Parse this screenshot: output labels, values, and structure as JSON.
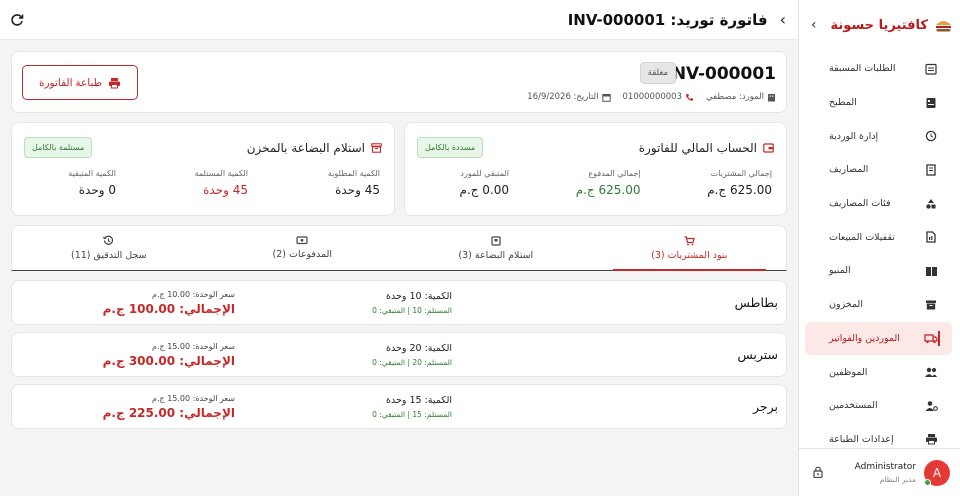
{
  "sidebar": {
    "title": "كافتيريا حسونة",
    "items": [
      {
        "label": "الطلبات المسبقة",
        "icon": "calendar-list-icon"
      },
      {
        "label": "المطبخ",
        "icon": "kitchen-icon"
      },
      {
        "label": "إدارة الوردية",
        "icon": "shift-clock-icon"
      },
      {
        "label": "المصاريف",
        "icon": "receipt-icon"
      },
      {
        "label": "فئات المصاريف",
        "icon": "categories-icon"
      },
      {
        "label": "تقفيلات المبيعات",
        "icon": "report-icon"
      },
      {
        "label": "المنيو",
        "icon": "menu-book-icon"
      },
      {
        "label": "المخزون",
        "icon": "inventory-icon"
      },
      {
        "label": "الموردين والفواتير",
        "icon": "truck-icon",
        "active": true
      },
      {
        "label": "الموظفين",
        "icon": "people-icon"
      },
      {
        "label": "المستخدمين",
        "icon": "user-settings-icon"
      },
      {
        "label": "إعدادات الطباعة",
        "icon": "printer-icon"
      }
    ],
    "user": {
      "name": "Administrator",
      "role": "مدير النظام",
      "initial": "A"
    }
  },
  "header": {
    "title": "فاتورة توريد: INV-000001"
  },
  "invoice": {
    "number": "INV-000001",
    "status": "مغلقة",
    "supplier": "المورد: مصطفي",
    "phone": "01000000003",
    "date": "التاريخ: 16/9/2026",
    "print_label": "طباعة الفاتورة"
  },
  "financial": {
    "title": "الحساب المالي للفاتورة",
    "badge": "مسددة بالكامل",
    "total_label": "إجمالي المشتريات",
    "total_value": "625.00 ج.م",
    "paid_label": "إجمالي المدفوع",
    "paid_value": "625.00 ج.م",
    "remaining_label": "المتبقي للمورد",
    "remaining_value": "0.00 ج.م"
  },
  "receiving": {
    "title": "استلام البضاعة بالمخزن",
    "badge": "مستلمة بالكامل",
    "requested_label": "الكمية المطلوبة",
    "requested_value": "45 وحدة",
    "received_label": "الكمية المستلمة",
    "received_value": "45 وحدة",
    "remaining_label": "الكمية المتبقية",
    "remaining_value": "0 وحدة"
  },
  "tabs": [
    {
      "label": "بنود المشتريات (3)",
      "icon": "cart-icon",
      "active": true
    },
    {
      "label": "استلام البضاعة (3)",
      "icon": "box-icon"
    },
    {
      "label": "المدفوعات (2)",
      "icon": "cash-icon"
    },
    {
      "label": "سجل التدقيق (11)",
      "icon": "history-icon"
    }
  ],
  "items": [
    {
      "name": "بطاطس",
      "qty": "الكمية: 10 وحدة",
      "recv": "المستلم: 10 | المتبقي: 0",
      "unit_price": "سعر الوحدة: 10.00 ج.م",
      "total": "الإجمالي: 100.00 ج.م"
    },
    {
      "name": "ستربس",
      "qty": "الكمية: 20 وحدة",
      "recv": "المستلم: 20 | المتبقي: 0",
      "unit_price": "سعر الوحدة: 15.00 ج.م",
      "total": "الإجمالي: 300.00 ج.م"
    },
    {
      "name": "برجر",
      "qty": "الكمية: 15 وحدة",
      "recv": "المستلم: 15 | المتبقي: 0",
      "unit_price": "سعر الوحدة: 15.00 ج.م",
      "total": "الإجمالي: 225.00 ج.م"
    }
  ],
  "colors": {
    "brand": "#c62828",
    "success": "#2e7d32",
    "active_bg": "#fde8e8"
  }
}
